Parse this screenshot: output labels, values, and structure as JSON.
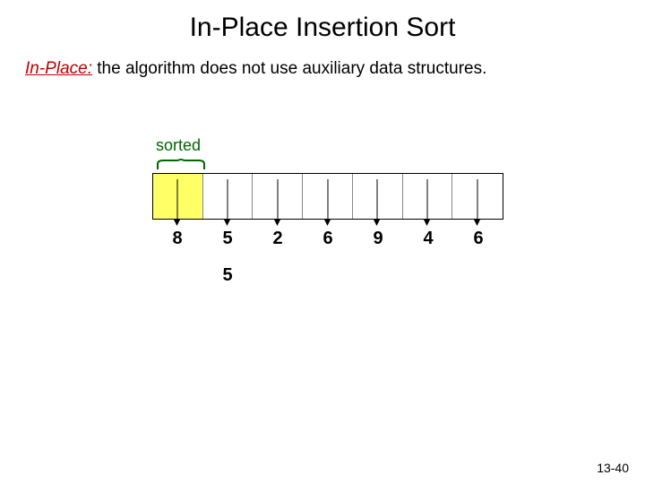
{
  "title": "In-Place Insertion Sort",
  "definition": {
    "term": "In-Place:",
    "rest": " the algorithm does not use auxiliary data structures."
  },
  "sorted_label": "sorted",
  "values": [
    "8",
    "5",
    "2",
    "6",
    "9",
    "4",
    "6"
  ],
  "extra_value": "5",
  "page_number": "13-40",
  "chart_data": {
    "type": "table",
    "title": "In-Place Insertion Sort state",
    "array": [
      8,
      5,
      2,
      6,
      9,
      4,
      6
    ],
    "sorted_count": 1,
    "current_key": 5,
    "current_index": 1
  }
}
